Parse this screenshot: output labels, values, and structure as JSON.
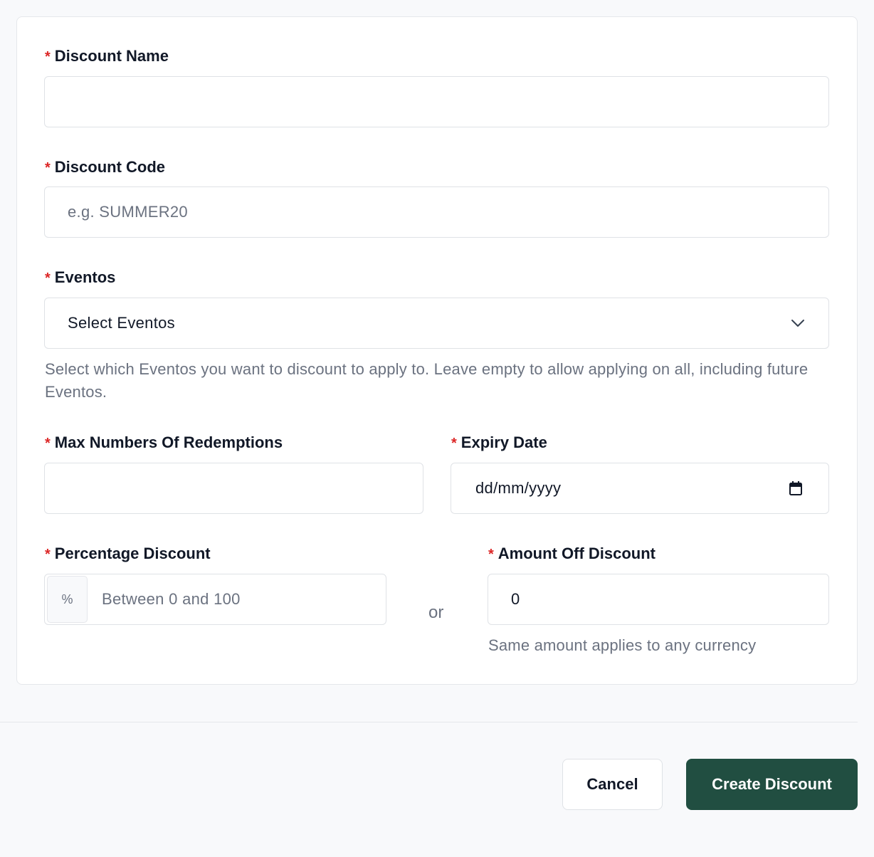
{
  "form": {
    "discount_name": {
      "label": "Discount Name",
      "required_mark": "*",
      "value": "",
      "placeholder": ""
    },
    "discount_code": {
      "label": "Discount Code",
      "required_mark": "*",
      "value": "",
      "placeholder": "e.g. SUMMER20"
    },
    "eventos": {
      "label": "Eventos",
      "required_mark": "*",
      "selected": "Select Eventos",
      "help": "Select which Eventos you want to discount to apply to. Leave empty to allow applying on all, including future Eventos."
    },
    "max_redemptions": {
      "label": "Max Numbers Of Redemptions",
      "required_mark": "*",
      "value": "",
      "placeholder": ""
    },
    "expiry_date": {
      "label": "Expiry Date",
      "required_mark": "*",
      "value": "dd/mm/yyyy"
    },
    "percentage_discount": {
      "label": "Percentage Discount",
      "required_mark": "*",
      "addon": "%",
      "value": "",
      "placeholder": "Between 0 and 100"
    },
    "or_text": "or",
    "amount_off": {
      "label": "Amount Off Discount",
      "required_mark": "*",
      "value": "0",
      "help": "Same amount applies to any currency"
    }
  },
  "actions": {
    "cancel_label": "Cancel",
    "create_label": "Create Discount"
  },
  "colors": {
    "primary": "#214e41",
    "required": "#dc2626",
    "muted_text": "#6b7280",
    "border": "#dfe2e6"
  }
}
